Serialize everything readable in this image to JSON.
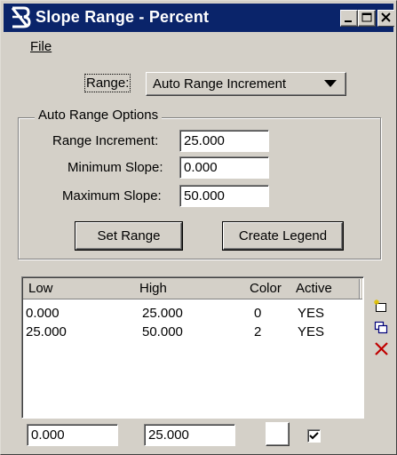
{
  "window": {
    "title": "Slope Range - Percent",
    "icon": "bentley-b-icon"
  },
  "menu": {
    "file_label": "File"
  },
  "range": {
    "label": "Range:",
    "selected": "Auto Range Increment"
  },
  "auto_range": {
    "group_title": "Auto Range Options",
    "increment_label": "Range Increment:",
    "increment_value": "25.000",
    "min_label": "Minimum Slope:",
    "min_value": "0.000",
    "max_label": "Maximum Slope:",
    "max_value": "50.000",
    "set_range_label": "Set Range",
    "create_legend_label": "Create Legend"
  },
  "table": {
    "columns": [
      "Low",
      "High",
      "Color",
      "Active"
    ],
    "rows": [
      {
        "low": "0.000",
        "high": "25.000",
        "color": "0",
        "active": "YES"
      },
      {
        "low": "25.000",
        "high": "50.000",
        "color": "2",
        "active": "YES"
      }
    ]
  },
  "editor": {
    "low_value": "0.000",
    "high_value": "25.000",
    "color_swatch": "#ffffff",
    "active_checked": true
  },
  "side_icons": [
    "new-row-icon",
    "copy-row-icon",
    "delete-row-icon"
  ],
  "colors": {
    "titlebar": "#0a246a",
    "face": "#d4d0c8",
    "delete": "#c00000"
  }
}
